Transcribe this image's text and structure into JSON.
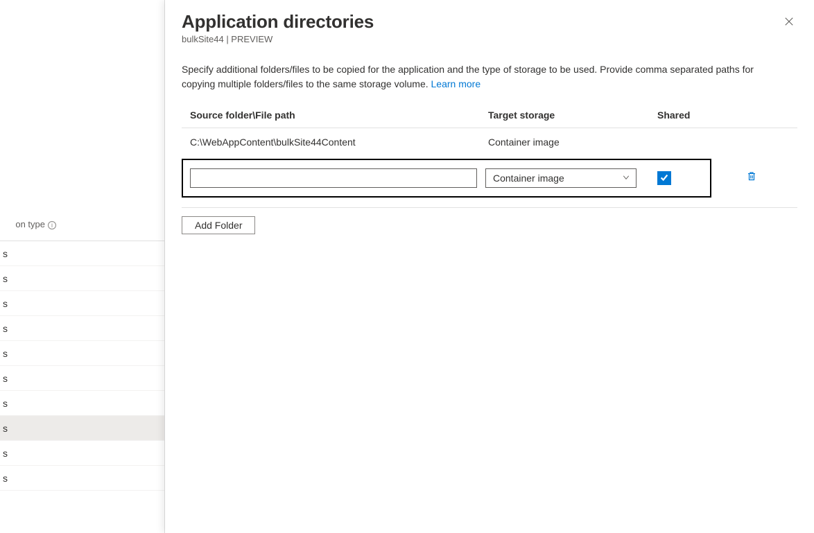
{
  "left_panel": {
    "filter_label": "on type",
    "rows": [
      "s",
      "s",
      "s",
      "s",
      "s",
      "s",
      "s",
      "s",
      "s",
      "s"
    ],
    "active_index": 7
  },
  "blade": {
    "title": "Application directories",
    "subtitle": "bulkSite44 | PREVIEW",
    "description": "Specify additional folders/files to be copied for the application and the type of storage to be used. Provide comma separated paths for copying multiple folders/files to the same storage volume. ",
    "learn_more": "Learn more",
    "columns": {
      "source": "Source folder\\File path",
      "target": "Target storage",
      "shared": "Shared"
    },
    "rows": [
      {
        "source": "C:\\WebAppContent\\bulkSite44Content",
        "target": "Container image"
      }
    ],
    "form_row": {
      "source_value": "",
      "target_selected": "Container image",
      "shared_checked": true
    },
    "add_button": "Add Folder"
  }
}
